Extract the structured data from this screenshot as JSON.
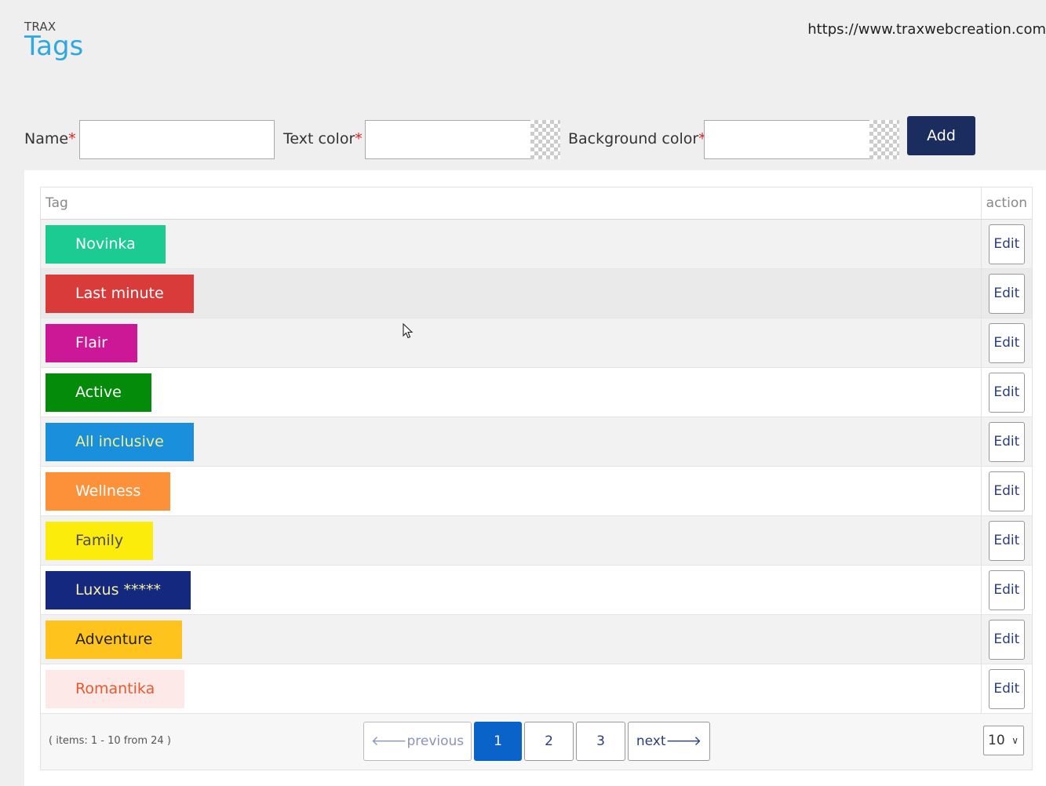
{
  "header": {
    "brand": "TRAX",
    "title": "Tags",
    "site_url": "https://www.traxwebcreation.com"
  },
  "form": {
    "name_label": "Name",
    "text_color_label": "Text color",
    "background_color_label": "Background color",
    "required_mark": "*",
    "add_label": "Add"
  },
  "table": {
    "col_tag": "Tag",
    "col_action": "action",
    "edit_label": "Edit",
    "rows": [
      {
        "label": "Novinka",
        "bg": "#1ccb92",
        "fg": "#ffffff"
      },
      {
        "label": "Last minute",
        "bg": "#d93b3b",
        "fg": "#ffffff"
      },
      {
        "label": "Flair",
        "bg": "#cc1797",
        "fg": "#ffffff"
      },
      {
        "label": "Active",
        "bg": "#058b0a",
        "fg": "#ffffff"
      },
      {
        "label": "All inclusive",
        "bg": "#1a8fdc",
        "fg": "#f4f08a"
      },
      {
        "label": "Wellness",
        "bg": "#fd913a",
        "fg": "#ffffff"
      },
      {
        "label": "Family",
        "bg": "#fcec0c",
        "fg": "#4a4a6a"
      },
      {
        "label": "Luxus *****",
        "bg": "#13287e",
        "fg": "#f6f0a0"
      },
      {
        "label": "Adventure",
        "bg": "#fec31d",
        "fg": "#222222"
      },
      {
        "label": "Romantika",
        "bg": "#fde9e7",
        "fg": "#e55a30"
      }
    ]
  },
  "footer": {
    "items_info": "( items: 1 - 10 from 24 )",
    "previous_label": "previous",
    "next_label": "next",
    "pages": [
      "1",
      "2",
      "3"
    ],
    "current_page": "1",
    "per_page": "10"
  },
  "colors": {
    "accent": "#2ea8e0",
    "primary_button": "#1b2d5e",
    "active_page": "#0a63c9"
  }
}
